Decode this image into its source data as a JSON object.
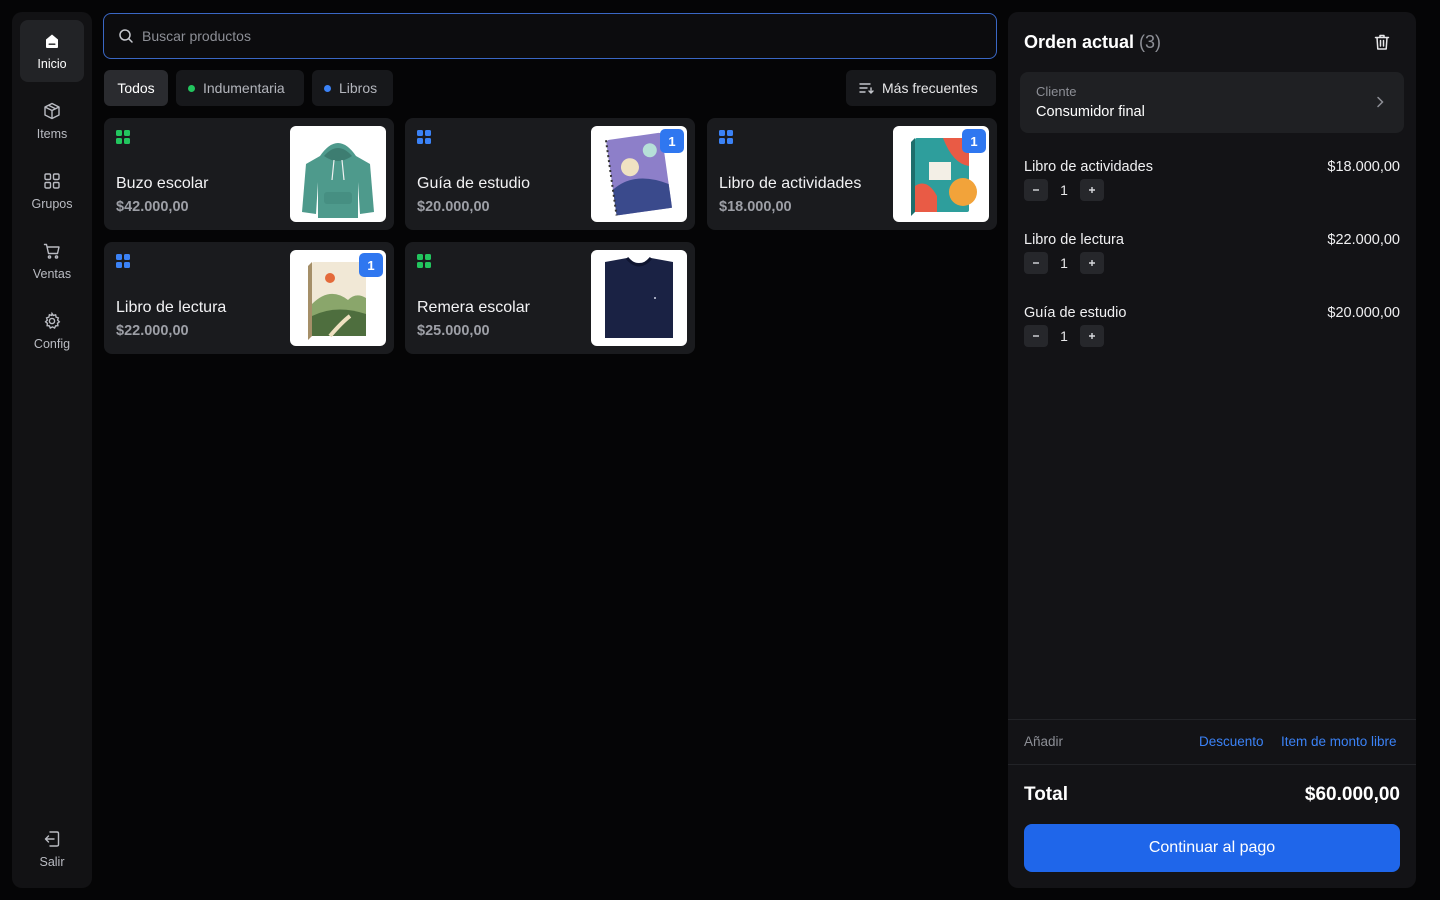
{
  "sidebar": {
    "items": [
      {
        "label": "Inicio",
        "icon": "home-icon",
        "active": true
      },
      {
        "label": "Items",
        "icon": "box-icon"
      },
      {
        "label": "Grupos",
        "icon": "grid-icon"
      },
      {
        "label": "Ventas",
        "icon": "cart-icon"
      },
      {
        "label": "Config",
        "icon": "gear-icon"
      }
    ],
    "logout": {
      "label": "Salir",
      "icon": "logout-icon"
    }
  },
  "search": {
    "placeholder": "Buscar productos",
    "value": ""
  },
  "filters": {
    "all": "Todos",
    "clothing": {
      "label": "Indumentaria",
      "color": "#22c55e"
    },
    "books": {
      "label": "Libros",
      "color": "#3b82f6"
    },
    "sort": "Más frecuentes"
  },
  "products": [
    {
      "name": "Buzo escolar",
      "price": "$42.000,00",
      "group_color": "#22c55e",
      "qty": ""
    },
    {
      "name": "Guía de estudio",
      "price": "$20.000,00",
      "group_color": "#3b82f6",
      "qty": "1"
    },
    {
      "name": "Libro de actividades",
      "price": "$18.000,00",
      "group_color": "#3b82f6",
      "qty": "1"
    },
    {
      "name": "Libro de lectura",
      "price": "$22.000,00",
      "group_color": "#3b82f6",
      "qty": "1"
    },
    {
      "name": "Remera escolar",
      "price": "$25.000,00",
      "group_color": "#22c55e",
      "qty": ""
    }
  ],
  "order": {
    "title": "Orden actual",
    "count": "(3)",
    "client_label": "Cliente",
    "client_value": "Consumidor final",
    "lines": [
      {
        "name": "Libro de actividades",
        "price": "$18.000,00",
        "qty": "1"
      },
      {
        "name": "Libro de lectura",
        "price": "$22.000,00",
        "qty": "1"
      },
      {
        "name": "Guía de estudio",
        "price": "$20.000,00",
        "qty": "1"
      }
    ],
    "add_label": "Añadir",
    "discount_link": "Descuento",
    "free_item_link": "Item de monto libre",
    "total_label": "Total",
    "total_value": "$60.000,00",
    "pay_button": "Continuar al pago"
  },
  "colors": {
    "accent": "#1f66ea",
    "clothing": "#22c55e",
    "books": "#3b82f6"
  }
}
